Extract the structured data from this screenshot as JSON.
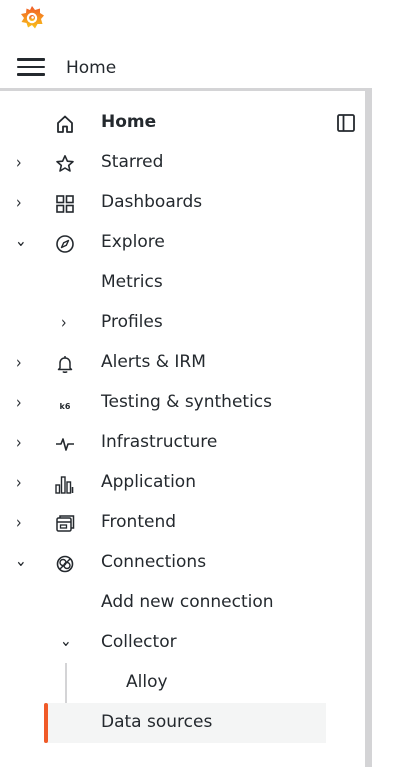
{
  "header": {
    "breadcrumb": "Home"
  },
  "nav": {
    "home": "Home",
    "starred": "Starred",
    "dashboards": "Dashboards",
    "explore": "Explore",
    "metrics": "Metrics",
    "profiles": "Profiles",
    "alerts": "Alerts & IRM",
    "testing": "Testing & synthetics",
    "testing_icon_text": "k6",
    "infrastructure": "Infrastructure",
    "application": "Application",
    "frontend": "Frontend",
    "connections": "Connections",
    "add_connection": "Add new connection",
    "collector": "Collector",
    "alloy": "Alloy",
    "data_sources": "Data sources"
  },
  "colors": {
    "accent": "#f05a28",
    "active_bg": "#f4f5f5",
    "border": "#d4d4d6"
  }
}
